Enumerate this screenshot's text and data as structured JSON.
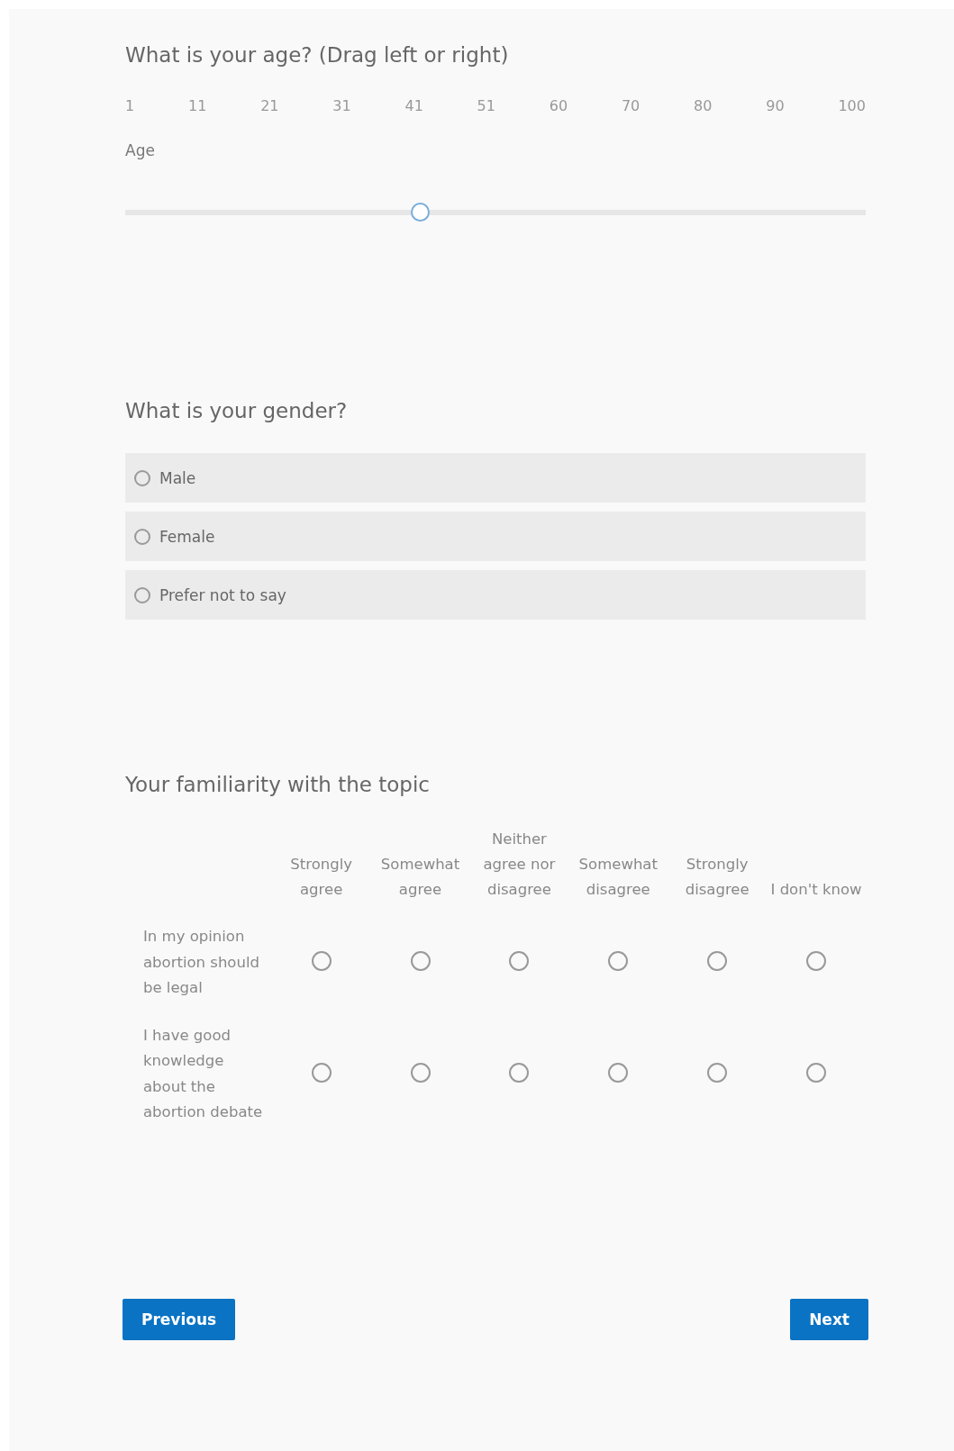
{
  "age_question": {
    "title": "What is your age? (Drag left or right)",
    "ticks": [
      "1",
      "11",
      "21",
      "31",
      "41",
      "51",
      "60",
      "70",
      "80",
      "90",
      "100"
    ],
    "label": "Age",
    "slider": {
      "level": 0.4
    }
  },
  "gender_question": {
    "title": "What is your gender?",
    "options": [
      {
        "label": "Male",
        "selected": false
      },
      {
        "label": "Female",
        "selected": false
      },
      {
        "label": "Prefer not to say",
        "selected": false
      }
    ]
  },
  "familiarity_question": {
    "title": "Your familiarity with the topic",
    "columns": [
      "Strongly agree",
      "Somewhat agree",
      "Neither agree nor disagree",
      "Somewhat disagree",
      "Strongly disagree",
      "I don't know"
    ],
    "rows": [
      {
        "label": "In my opinion abortion should be legal",
        "choices": [
          {
            "selected": false
          },
          {
            "selected": false
          },
          {
            "selected": false
          },
          {
            "selected": false
          },
          {
            "selected": false
          },
          {
            "selected": false
          }
        ]
      },
      {
        "label": "I have good knowledge about the abortion debate",
        "choices": [
          {
            "selected": false
          },
          {
            "selected": false
          },
          {
            "selected": false
          },
          {
            "selected": false
          },
          {
            "selected": false
          },
          {
            "selected": false
          }
        ]
      }
    ]
  },
  "buttons": {
    "previous": "Previous",
    "next": "Next"
  }
}
